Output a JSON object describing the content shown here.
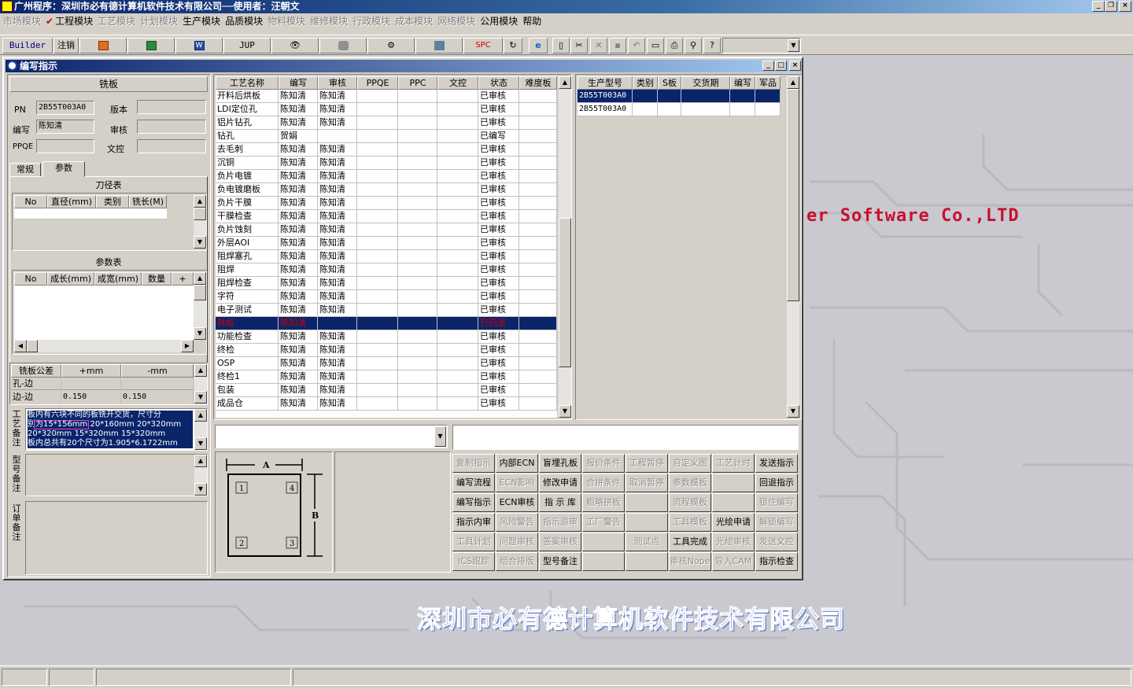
{
  "app": {
    "title": "广州程序：深圳市必有德计算机软件技术有限公司──使用者：汪朝文",
    "brand_text": "er Software Co.,LTD",
    "company_text": "深圳市必有德计算机软件技术有限公司"
  },
  "menu": [
    {
      "label": "市场模块",
      "enabled": false
    },
    {
      "label": "工程模块",
      "enabled": true,
      "checked": true
    },
    {
      "label": "工艺模块",
      "enabled": false
    },
    {
      "label": "计划模块",
      "enabled": false
    },
    {
      "label": "生产模块",
      "enabled": true
    },
    {
      "label": "品质模块",
      "enabled": true
    },
    {
      "label": "物料模块",
      "enabled": false
    },
    {
      "label": "维修模块",
      "enabled": false
    },
    {
      "label": "行政模块",
      "enabled": false
    },
    {
      "label": "成本模块",
      "enabled": false
    },
    {
      "label": "网络模块",
      "enabled": false
    },
    {
      "label": "公用模块",
      "enabled": true
    },
    {
      "label": "帮助",
      "enabled": true
    }
  ],
  "toolbar": {
    "builder": "Builder",
    "logout": "注销",
    "jup": "JUP",
    "spc": "SPC"
  },
  "window": {
    "title": "编写指示"
  },
  "left": {
    "section_title": "铣板",
    "pn_label": "PN",
    "pn_value": "2B55T003A0",
    "version_label": "版本",
    "version_value": "",
    "writer_label": "编写",
    "writer_value": "陈知清",
    "audit_label": "审核",
    "audit_value": "",
    "ppqe_label": "PPQE",
    "ppqe_value": "",
    "doc_label": "文控",
    "doc_value": "",
    "tabs": [
      "常规",
      "参数"
    ],
    "tool_table_title": "刀径表",
    "tool_headers": [
      "No",
      "直径(mm)",
      "类别",
      "铣长(M)"
    ],
    "param_table_title": "参数表",
    "param_headers": [
      "No",
      "成长(mm)",
      "成宽(mm)",
      "数量",
      "+"
    ],
    "tol_headers": [
      "铣板公差",
      "+mm",
      "-mm"
    ],
    "tol_rows": [
      {
        "name": "孔-边",
        "plus": "",
        "minus": ""
      },
      {
        "name": "边-边",
        "plus": "0.150",
        "minus": "0.150"
      }
    ],
    "process_note_label": "工艺备注",
    "process_note_lines": [
      "板内有六块不同的板铣开交货，尺寸分",
      "别为15*156mm   20*160mm  20*320mm",
      "20*320mm   15*320mm   15*320mm",
      "板内总共有20个尺寸为1.905*6.1722mm"
    ],
    "model_note_label": "型号备注",
    "order_note_label": "订单备注"
  },
  "process_grid": {
    "headers": [
      "工艺名称",
      "编写",
      "审核",
      "PPQE",
      "PPC",
      "文控",
      "状态",
      "难度板"
    ],
    "rows": [
      [
        "开料后烘板",
        "陈知清",
        "陈知清",
        "",
        "",
        "",
        "已审核",
        ""
      ],
      [
        "LDI定位孔",
        "陈知清",
        "陈知清",
        "",
        "",
        "",
        "已审核",
        ""
      ],
      [
        "铝片钻孔",
        "陈知清",
        "陈知清",
        "",
        "",
        "",
        "已审核",
        ""
      ],
      [
        "钻孔",
        "贺娟",
        "",
        "",
        "",
        "",
        "已编写",
        ""
      ],
      [
        "去毛刺",
        "陈知清",
        "陈知清",
        "",
        "",
        "",
        "已审核",
        ""
      ],
      [
        "沉铜",
        "陈知清",
        "陈知清",
        "",
        "",
        "",
        "已审核",
        ""
      ],
      [
        "负片电镀",
        "陈知清",
        "陈知清",
        "",
        "",
        "",
        "已审核",
        ""
      ],
      [
        "负电镀磨板",
        "陈知清",
        "陈知清",
        "",
        "",
        "",
        "已审核",
        ""
      ],
      [
        "负片干膜",
        "陈知清",
        "陈知清",
        "",
        "",
        "",
        "已审核",
        ""
      ],
      [
        "干膜检查",
        "陈知清",
        "陈知清",
        "",
        "",
        "",
        "已审核",
        ""
      ],
      [
        "负片蚀刻",
        "陈知清",
        "陈知清",
        "",
        "",
        "",
        "已审核",
        ""
      ],
      [
        "外层AOI",
        "陈知清",
        "陈知清",
        "",
        "",
        "",
        "已审核",
        ""
      ],
      [
        "阻焊塞孔",
        "陈知清",
        "陈知清",
        "",
        "",
        "",
        "已审核",
        ""
      ],
      [
        "阻焊",
        "陈知清",
        "陈知清",
        "",
        "",
        "",
        "已审核",
        ""
      ],
      [
        "阻焊检查",
        "陈知清",
        "陈知清",
        "",
        "",
        "",
        "已审核",
        ""
      ],
      [
        "字符",
        "陈知清",
        "陈知清",
        "",
        "",
        "",
        "已审核",
        ""
      ],
      [
        "电子测试",
        "陈知清",
        "陈知清",
        "",
        "",
        "",
        "已审核",
        ""
      ],
      [
        "铣板",
        "陈知清",
        "",
        "",
        "",
        "",
        "已回退",
        ""
      ],
      [
        "功能检查",
        "陈知清",
        "陈知清",
        "",
        "",
        "",
        "已审核",
        ""
      ],
      [
        "终检",
        "陈知清",
        "陈知清",
        "",
        "",
        "",
        "已审核",
        ""
      ],
      [
        "OSP",
        "陈知清",
        "陈知清",
        "",
        "",
        "",
        "已审核",
        ""
      ],
      [
        "终检1",
        "陈知清",
        "陈知清",
        "",
        "",
        "",
        "已审核",
        ""
      ],
      [
        "包装",
        "陈知清",
        "陈知清",
        "",
        "",
        "",
        "已审核",
        ""
      ],
      [
        "成品仓",
        "陈知清",
        "陈知清",
        "",
        "",
        "",
        "已审核",
        ""
      ]
    ],
    "selected_row": 17
  },
  "model_grid": {
    "headers": [
      "生产型号",
      "类别",
      "S板",
      "交货期",
      "编写",
      "军品"
    ],
    "rows": [
      [
        "2B55T003A0",
        "",
        "",
        "",
        "",
        ""
      ],
      [
        "2B55T003A0",
        "",
        "",
        "",
        "",
        ""
      ]
    ],
    "selected_row": 0
  },
  "diagram": {
    "a_label": "A",
    "b_label": "B",
    "corners": [
      "1",
      "4",
      "2",
      "3"
    ]
  },
  "actions": [
    [
      {
        "label": "复制指示",
        "enabled": false
      },
      {
        "label": "内部ECN",
        "enabled": true
      },
      {
        "label": "盲埋孔板",
        "enabled": true
      },
      {
        "label": "报价条件",
        "enabled": false
      },
      {
        "label": "工程暂停",
        "enabled": false
      },
      {
        "label": "自定义图",
        "enabled": false
      },
      {
        "label": "工艺计时",
        "enabled": false
      },
      {
        "label": "发送指示",
        "enabled": true
      }
    ],
    [
      {
        "label": "编写流程",
        "enabled": true
      },
      {
        "label": "ECN影响",
        "enabled": false
      },
      {
        "label": "修改申请",
        "enabled": true
      },
      {
        "label": "合拼条件",
        "enabled": false
      },
      {
        "label": "取消暂停",
        "enabled": false
      },
      {
        "label": "参数模板",
        "enabled": false
      },
      {
        "label": "",
        "enabled": false
      },
      {
        "label": "回退指示",
        "enabled": true
      }
    ],
    [
      {
        "label": "编写指示",
        "enabled": true
      },
      {
        "label": "ECN审核",
        "enabled": true
      },
      {
        "label": "指 示 库",
        "enabled": true
      },
      {
        "label": "粗略拼板",
        "enabled": false
      },
      {
        "label": "",
        "enabled": false
      },
      {
        "label": "流程模板",
        "enabled": false
      },
      {
        "label": "",
        "enabled": false
      },
      {
        "label": "锁住编写",
        "enabled": false
      }
    ],
    [
      {
        "label": "指示内审",
        "enabled": true
      },
      {
        "label": "风险警告",
        "enabled": false
      },
      {
        "label": "指示退审",
        "enabled": false
      },
      {
        "label": "工厂警告",
        "enabled": false
      },
      {
        "label": "",
        "enabled": false
      },
      {
        "label": "工具模板",
        "enabled": false
      },
      {
        "label": "光绘申请",
        "enabled": true
      },
      {
        "label": "解锁编写",
        "enabled": false
      }
    ],
    [
      {
        "label": "工具计划",
        "enabled": false
      },
      {
        "label": "问题审核",
        "enabled": false
      },
      {
        "label": "答案审核",
        "enabled": false
      },
      {
        "label": "",
        "enabled": false
      },
      {
        "label": "测试点",
        "enabled": false
      },
      {
        "label": "工具完成",
        "enabled": true
      },
      {
        "label": "光绘审核",
        "enabled": false
      },
      {
        "label": "发送文控",
        "enabled": false
      }
    ],
    [
      {
        "label": "ICS跟踪",
        "enabled": false
      },
      {
        "label": "组合排版",
        "enabled": false
      },
      {
        "label": "型号备注",
        "enabled": true
      },
      {
        "label": "",
        "enabled": false
      },
      {
        "label": "",
        "enabled": false
      },
      {
        "label": "审核Nope",
        "enabled": false
      },
      {
        "label": "导入CAM",
        "enabled": false
      },
      {
        "label": "指示检查",
        "enabled": true
      }
    ]
  ]
}
